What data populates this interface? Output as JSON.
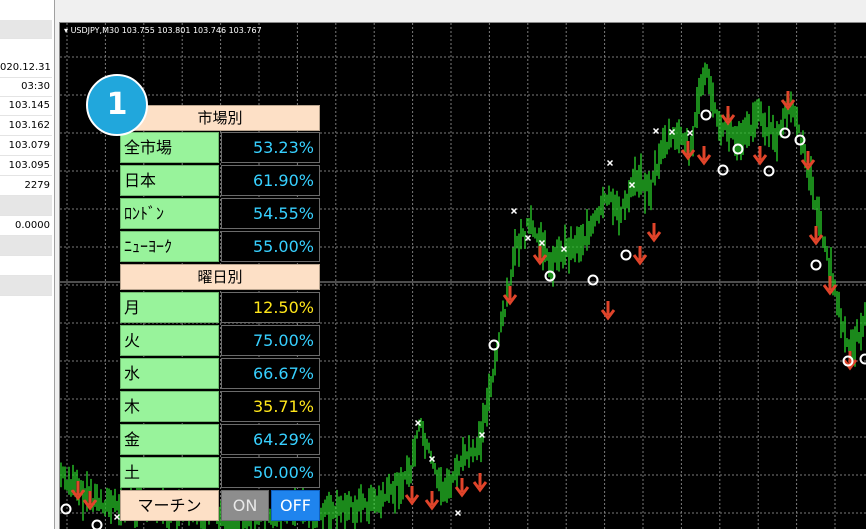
{
  "left_panel": {
    "rows": [
      "020.12.31",
      "03:30",
      "103.145",
      "103.162",
      "103.079",
      "103.095",
      "2279",
      "",
      "0.0000",
      "",
      "",
      ""
    ]
  },
  "chart": {
    "title": "USDJPY,M30  103.755 103.801 103.746 103.767",
    "colors": {
      "background": "#000000",
      "grid": "#7a7a7a",
      "bars": "#27c427",
      "arrow": "#e0442a",
      "mark": "#ffffff"
    }
  },
  "badge": {
    "label": "1"
  },
  "stats": {
    "market_header": "市場別",
    "markets": [
      {
        "label": "全市場",
        "value": "53.23%"
      },
      {
        "label": "日本",
        "value": "61.90%"
      },
      {
        "label": "ﾛﾝﾄﾞﾝ",
        "value": "54.55%"
      },
      {
        "label": "ﾆｭｰﾖｰｸ",
        "value": "55.00%"
      }
    ],
    "weekday_header": "曜日別",
    "weekdays": [
      {
        "label": "月",
        "value": "12.50%",
        "color": "yellow"
      },
      {
        "label": "火",
        "value": "75.00%",
        "color": "cyan"
      },
      {
        "label": "水",
        "value": "66.67%",
        "color": "cyan"
      },
      {
        "label": "木",
        "value": "35.71%",
        "color": "yellow"
      },
      {
        "label": "金",
        "value": "64.29%",
        "color": "cyan"
      },
      {
        "label": "土",
        "value": "50.00%",
        "color": "cyan"
      }
    ],
    "martin_label": "マーチン",
    "on_label": "ON",
    "off_label": "OFF"
  }
}
